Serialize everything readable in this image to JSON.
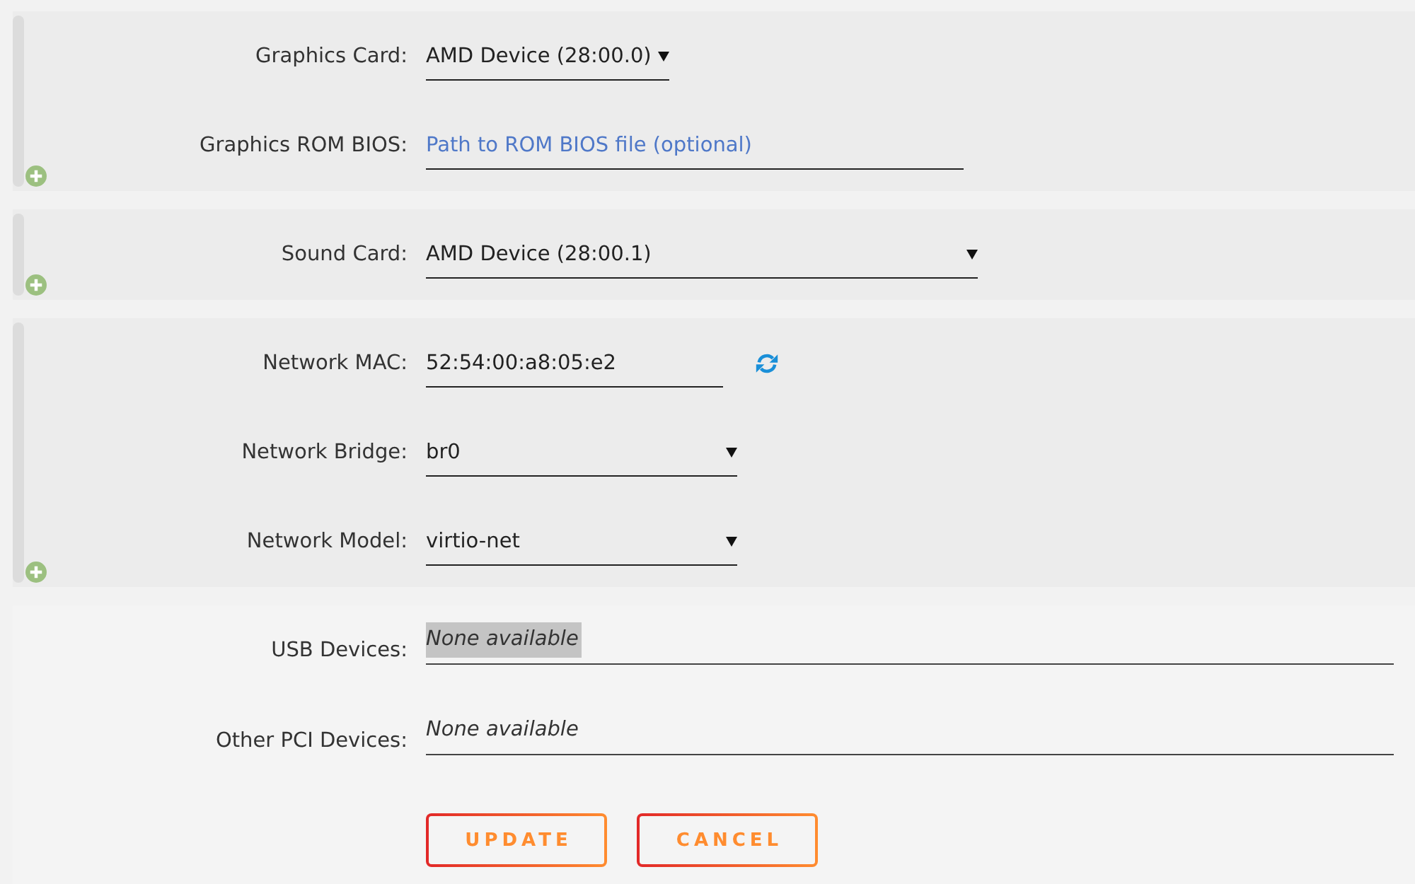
{
  "device_groups": [
    {
      "rows": [
        {
          "label": "Graphics Card:",
          "field": {
            "kind": "select",
            "value": "AMD Device (28:00.0)"
          }
        },
        {
          "label": "Graphics ROM BIOS:",
          "field": {
            "kind": "text",
            "placeholder": "Path to ROM BIOS file (optional)"
          }
        }
      ]
    },
    {
      "rows": [
        {
          "label": "Sound Card:",
          "field": {
            "kind": "select",
            "value": "AMD Device (28:00.1)"
          }
        }
      ]
    },
    {
      "rows": [
        {
          "label": "Network MAC:",
          "field": {
            "kind": "text",
            "value": "52:54:00:a8:05:e2"
          },
          "refresh": true
        },
        {
          "label": "Network Bridge:",
          "field": {
            "kind": "select",
            "value": "br0"
          }
        },
        {
          "label": "Network Model:",
          "field": {
            "kind": "select",
            "value": "virtio-net"
          }
        }
      ]
    }
  ],
  "passthrough": {
    "rows": [
      {
        "label": "USB Devices:",
        "field": {
          "kind": "multiselect",
          "options": [
            {
              "label": "None available",
              "selected": true
            }
          ]
        }
      },
      {
        "label": "Other PCI Devices:",
        "field": {
          "kind": "multiselect",
          "options": [
            {
              "label": "None available",
              "selected": false
            }
          ]
        }
      }
    ]
  },
  "buttons": [
    {
      "label": "UPDATE"
    },
    {
      "label": "CANCEL"
    }
  ]
}
